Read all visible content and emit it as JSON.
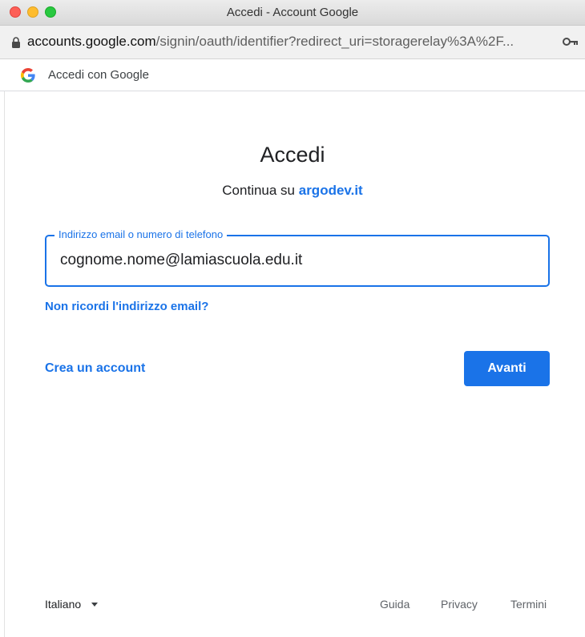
{
  "window": {
    "title": "Accedi - Account Google"
  },
  "address_bar": {
    "host": "accounts.google.com",
    "path": "/signin/oauth/identifier?redirect_uri=storagerelay%3A%2F..."
  },
  "subheader": {
    "label": "Accedi con Google"
  },
  "main": {
    "heading": "Accedi",
    "subtitle_prefix": "Continua su ",
    "subtitle_site": "argodev.it",
    "email_field": {
      "label": "Indirizzo email o numero di telefono",
      "value": "cognome.nome@lamiascuola.edu.it"
    },
    "forgot_email_link": "Non ricordi l'indirizzo email?",
    "create_account_link": "Crea un account",
    "next_button": "Avanti"
  },
  "footer": {
    "language": "Italiano",
    "help": "Guida",
    "privacy": "Privacy",
    "terms": "Termini"
  },
  "colors": {
    "accent": "#1a73e8",
    "text": "#202124",
    "muted": "#5f6368"
  },
  "icons": {
    "lock": "lock-icon",
    "key": "key-icon",
    "google": "google-g-icon",
    "caret": "caret-down-icon"
  }
}
